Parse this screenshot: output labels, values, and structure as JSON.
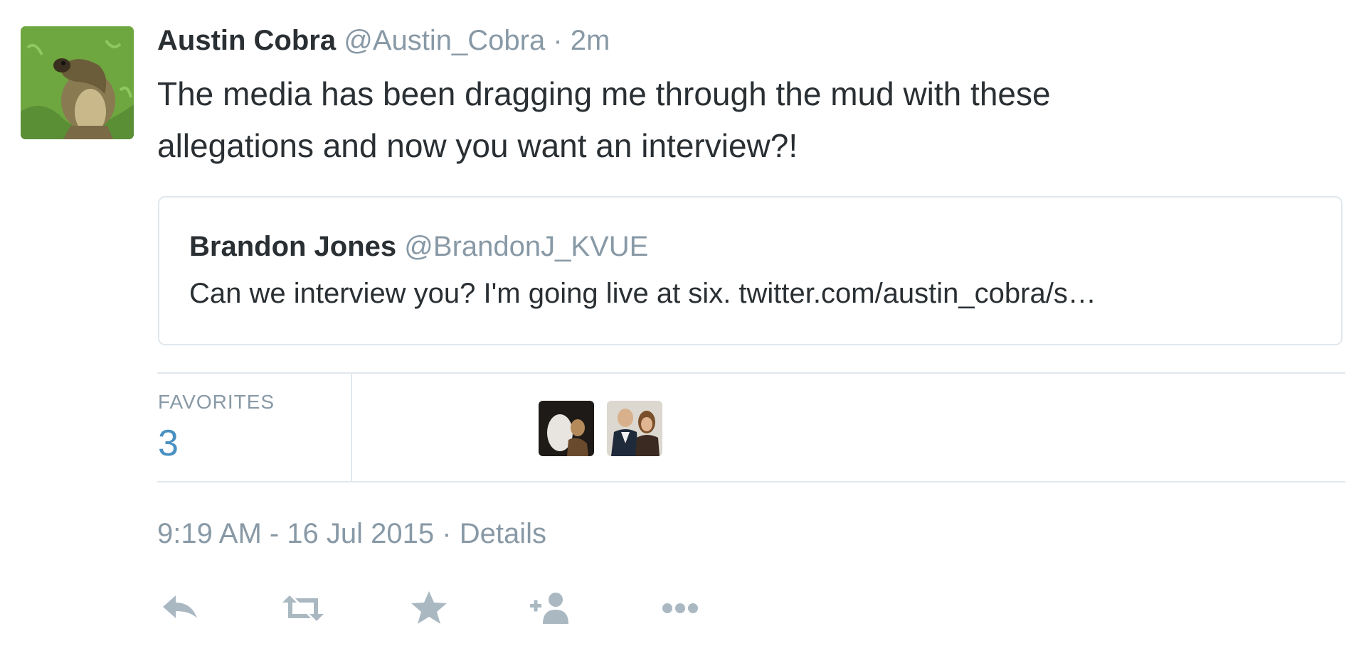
{
  "tweet": {
    "fullname": "Austin Cobra",
    "username": "@Austin_Cobra",
    "separator": "·",
    "timestamp": "2m",
    "text": "The media has been dragging me through the mud with these allegations and now you want an interview?!",
    "avatar_icon": "cobra-avatar"
  },
  "quoted_tweet": {
    "fullname": "Brandon Jones",
    "username": "@BrandonJ_KVUE",
    "text": "Can we interview you? I'm going live at six. twitter.com/austin_cobra/s…"
  },
  "stats": {
    "favorites_label": "FAVORITES",
    "favorites_count": "3",
    "favoriter_avatars": [
      "favoriter-avatar-1",
      "favoriter-avatar-2"
    ]
  },
  "meta": {
    "datetime": "9:19 AM - 16 Jul 2015",
    "separator": "·",
    "details_label": "Details"
  },
  "actions": [
    "reply-icon",
    "retweet-icon",
    "favorite-star-icon",
    "follow-icon",
    "more-icon"
  ],
  "colors": {
    "text": "#292f33",
    "muted": "#8899a6",
    "border": "#e1e8ed",
    "count": "#4a90c2",
    "icon": "#aab8c2"
  }
}
